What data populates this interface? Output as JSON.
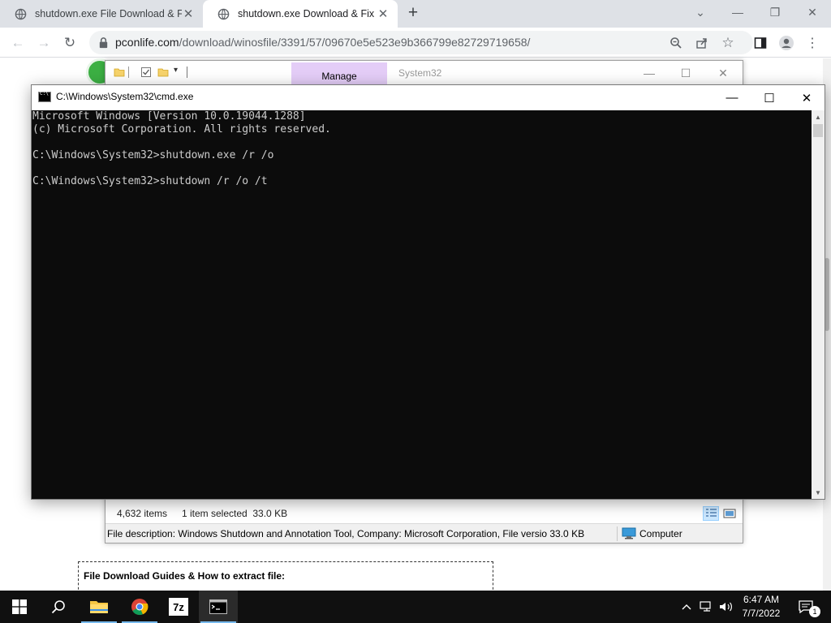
{
  "browser": {
    "tabs": [
      {
        "title": "shutdown.exe File Download & F",
        "active": false
      },
      {
        "title": "shutdown.exe Download & Fix Fi",
        "active": true
      }
    ],
    "url_host": "pconlife.com",
    "url_path": "/download/winosfile/3391/57/09670e5e523e9b366799e82729719658/",
    "page": {
      "guides_heading": "File Download Guides & How to extract file:"
    }
  },
  "explorer": {
    "ribbon_tab": "Manage",
    "path_label": "System32",
    "status_items": "4,632 items",
    "status_selected": "1 item selected  33.0 KB",
    "file_description": "File description: Windows Shutdown and Annotation Tool, Company: Microsoft Corporation, File versio 33.0 KB",
    "location": "Computer"
  },
  "cmd": {
    "title": "C:\\Windows\\System32\\cmd.exe",
    "lines": [
      "Microsoft Windows [Version 10.0.19044.1288]",
      "(c) Microsoft Corporation. All rights reserved.",
      "",
      "C:\\Windows\\System32>shutdown.exe /r /o",
      "",
      "C:\\Windows\\System32>shutdown /r /o /t"
    ]
  },
  "taskbar": {
    "time": "6:47 AM",
    "date": "7/7/2022",
    "notification_count": "1",
    "sevenzip_label": "7z",
    "accent_color": "#76b9ed"
  }
}
